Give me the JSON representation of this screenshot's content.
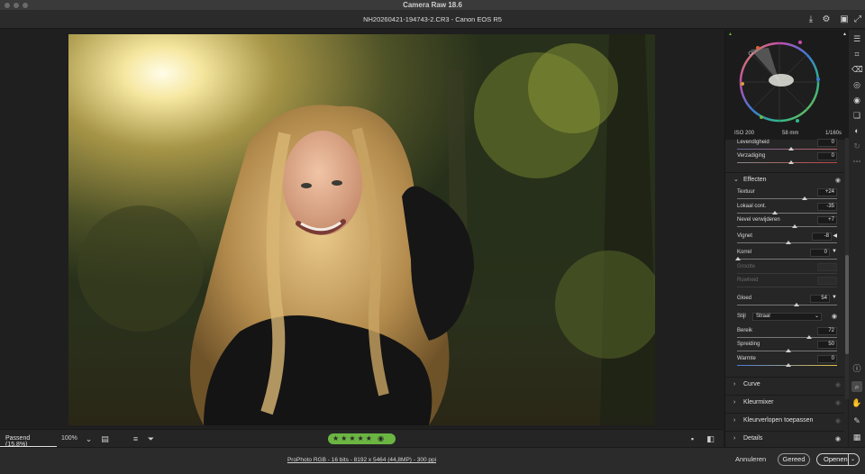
{
  "window": {
    "title": "Camera Raw 18.6"
  },
  "header": {
    "filename": "NH20260421-194743-2.CR3  -  Canon EOS R5"
  },
  "exif": {
    "iso": "ISO 200",
    "focal": "58 mm",
    "shutter": "1/160s"
  },
  "adjustments_top": [
    {
      "label": "Levendigheid",
      "value": "0"
    },
    {
      "label": "Verzadiging",
      "value": "0"
    }
  ],
  "effects": {
    "title": "Effecten",
    "texture": {
      "label": "Textuur",
      "value": "+24"
    },
    "clarity": {
      "label": "Lokaal cont.",
      "value": "-35"
    },
    "dehaze": {
      "label": "Nevel verwijderen",
      "value": "+7"
    },
    "vignette": {
      "label": "Vignet",
      "value": "-8"
    },
    "grain": {
      "label": "Korrel",
      "value": "0"
    },
    "grain_size": {
      "label": "Grootte",
      "value": ""
    },
    "grain_rough": {
      "label": "Ruwheid",
      "value": ""
    },
    "glow": {
      "label": "Gloed",
      "value": "54"
    },
    "style": {
      "label": "Stijl",
      "value": "Straal"
    },
    "range": {
      "label": "Bereik",
      "value": "72"
    },
    "spread": {
      "label": "Spreiding",
      "value": "50"
    },
    "warmth": {
      "label": "Warmte",
      "value": "0"
    }
  },
  "sections": [
    {
      "name": "Curve"
    },
    {
      "name": "Kleurmixer"
    },
    {
      "name": "Kleurverlopen toepassen"
    },
    {
      "name": "Details"
    }
  ],
  "bottom": {
    "zoom_fit": "Passend (15,8%)",
    "zoom_100": "100%",
    "stars": "★★★★★"
  },
  "status": {
    "workflow": "ProPhoto RGB - 16 bits - 8192 x 5464 (44,8MP) - 300 ppi",
    "cancel": "Annuleren",
    "done": "Gereed",
    "open": "Openen"
  }
}
